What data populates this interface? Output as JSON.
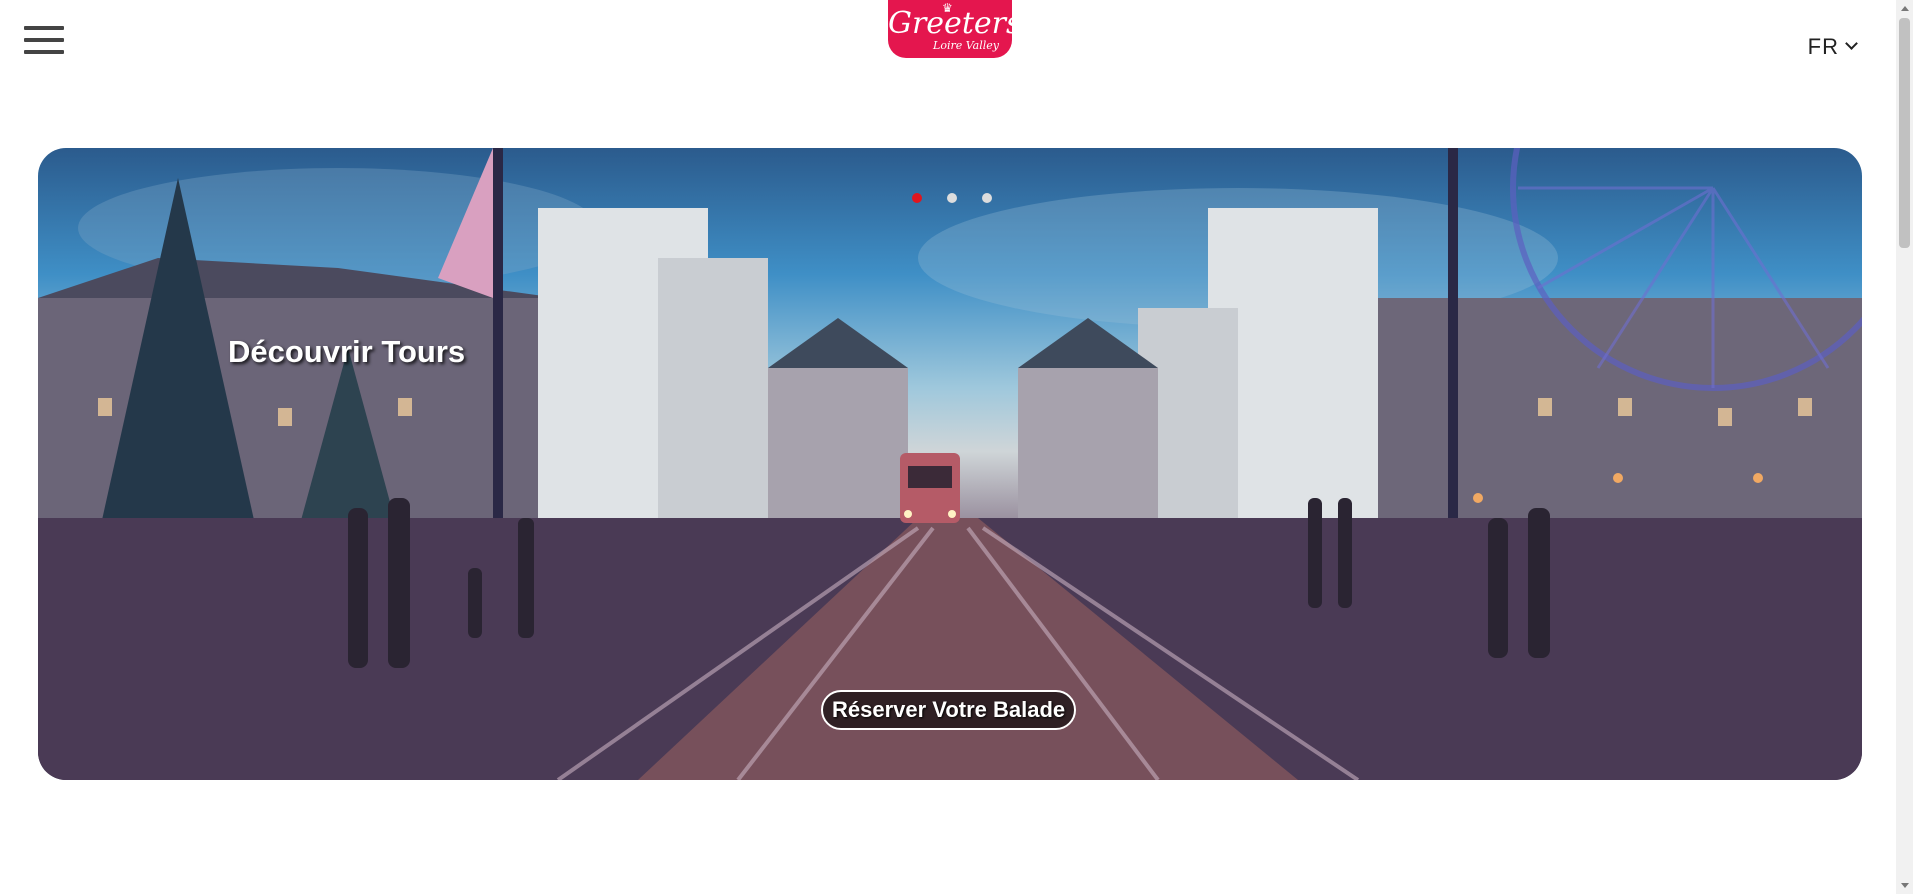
{
  "header": {
    "menu_icon": "hamburger-menu-icon",
    "logo": {
      "name": "Greeters",
      "subtitle": "Loire Valley",
      "color": "#e4164e"
    },
    "language": {
      "selected": "FR",
      "icon": "chevron-down-icon"
    }
  },
  "hero": {
    "title": "Découvrir Tours",
    "cta_label": "Réserver Votre Balade",
    "slides": [
      {
        "active": true
      },
      {
        "active": false
      },
      {
        "active": false
      }
    ],
    "active_dot_color": "#e0161e"
  },
  "scrollbar": {
    "icons": [
      "scroll-up-arrow-icon",
      "scroll-down-arrow-icon"
    ]
  }
}
